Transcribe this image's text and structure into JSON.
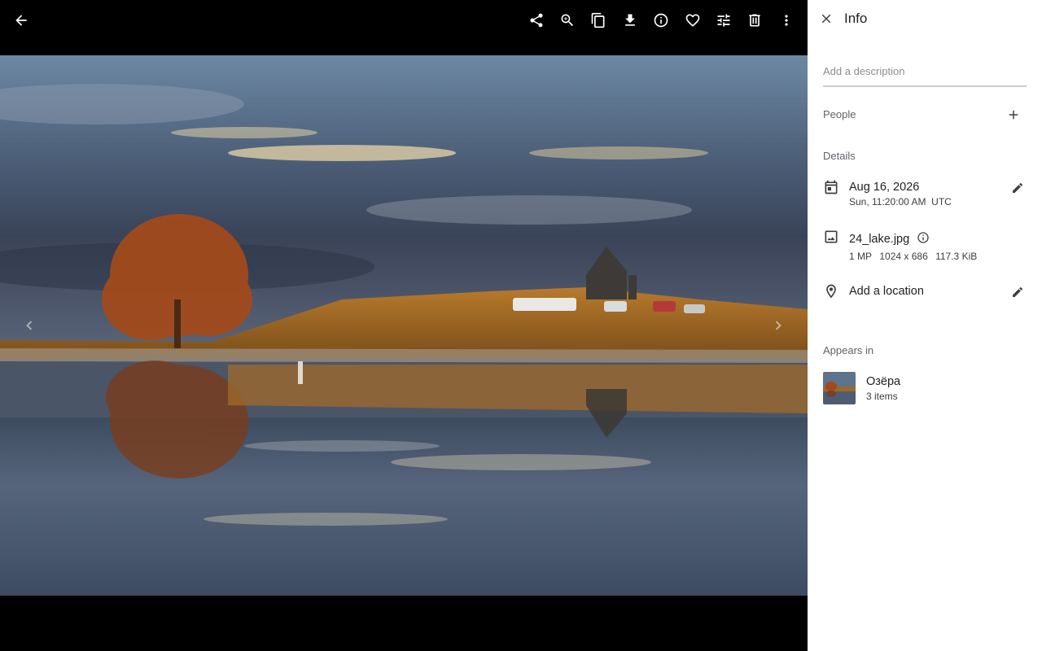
{
  "viewer": {
    "back_icon": "arrow-back-icon",
    "toolbar": [
      {
        "name": "share-button",
        "icon": "share-icon"
      },
      {
        "name": "zoom-button",
        "icon": "zoom-in-icon"
      },
      {
        "name": "copy-button",
        "icon": "copy-icon"
      },
      {
        "name": "download-button",
        "icon": "download-icon"
      },
      {
        "name": "info-button",
        "icon": "info-icon"
      },
      {
        "name": "favorite-button",
        "icon": "heart-icon"
      },
      {
        "name": "edit-button",
        "icon": "tune-icon"
      },
      {
        "name": "delete-button",
        "icon": "trash-icon"
      },
      {
        "name": "more-button",
        "icon": "more-vert-icon"
      }
    ],
    "photo_file": "24_lake.jpg"
  },
  "panel": {
    "title": "Info",
    "description_placeholder": "Add a description",
    "people_label": "People",
    "details_label": "Details",
    "date": {
      "primary": "Aug 16, 2026",
      "secondary": "Sun, 11:20:00 AM  UTC"
    },
    "file": {
      "name": "24_lake.jpg",
      "megapixels": "1 MP",
      "dimensions": "1024 x 686",
      "size": "117.3 KiB"
    },
    "location": {
      "label": "Add a location"
    },
    "appears_in_label": "Appears in",
    "album": {
      "name": "Озёра",
      "count": "3 items"
    }
  },
  "colors": {
    "panel_bg": "#ffffff",
    "viewer_bg": "#000000",
    "text_primary": "#202124",
    "text_secondary": "#5f6368"
  }
}
